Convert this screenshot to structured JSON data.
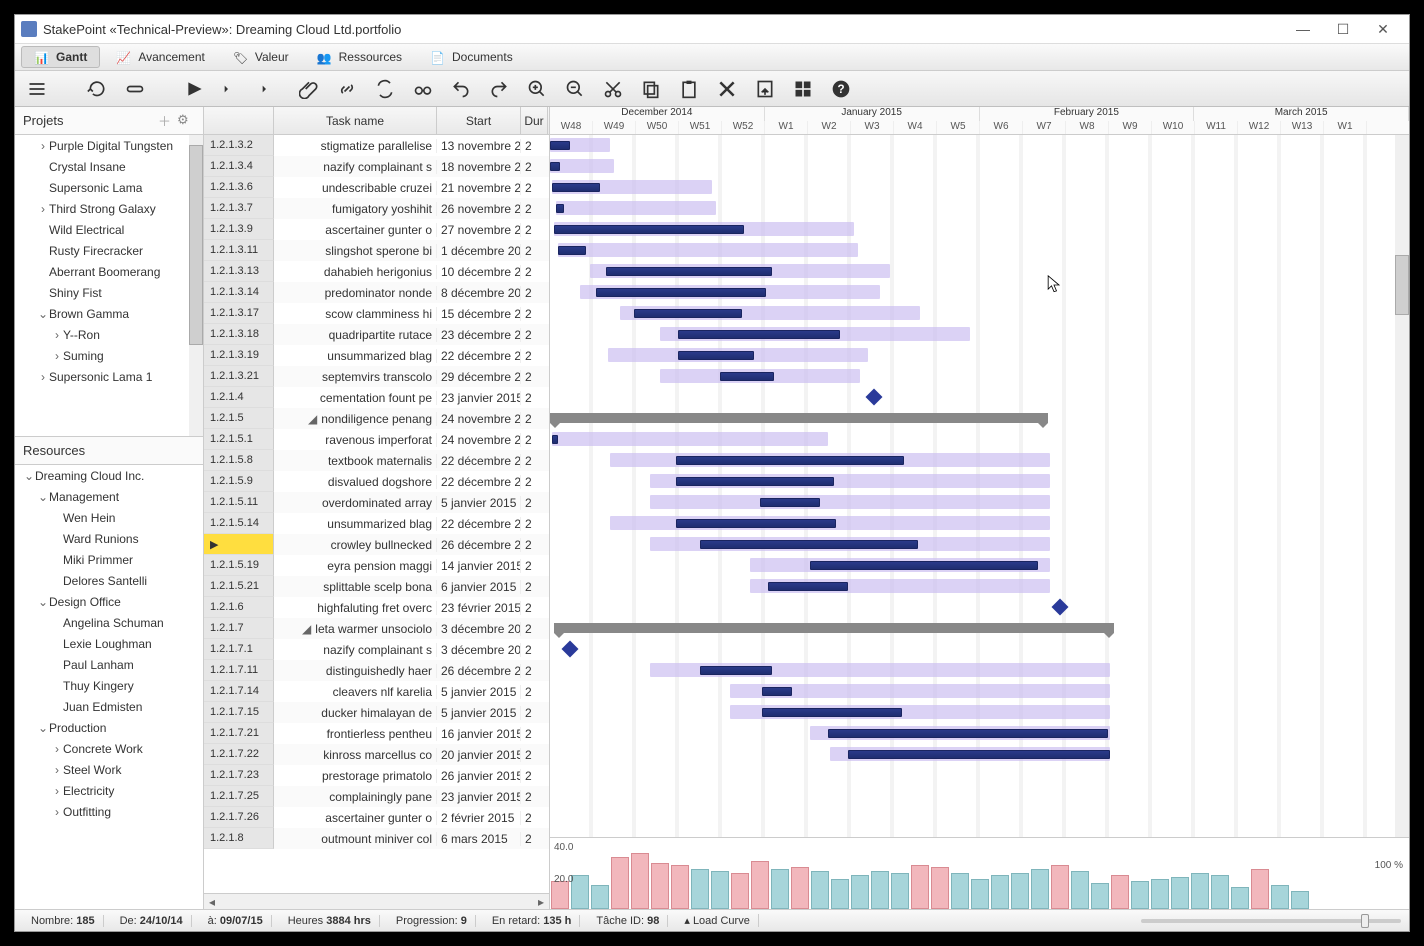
{
  "title": "StakePoint  «Technical-Preview»:  Dreaming Cloud Ltd.portfolio",
  "ribbon": {
    "tabs": [
      "Gantt",
      "Avancement",
      "Valeur",
      "Ressources",
      "Documents"
    ],
    "active": 0
  },
  "panels": {
    "projects": "Projets",
    "resources": "Resources"
  },
  "projects": [
    {
      "t": "Purple Digital Tungsten",
      "l": 1,
      "c": ">"
    },
    {
      "t": "Crystal Insane",
      "l": 1,
      "c": ""
    },
    {
      "t": "Supersonic Lama",
      "l": 1,
      "c": ""
    },
    {
      "t": "Third Strong Galaxy",
      "l": 1,
      "c": ">"
    },
    {
      "t": "Wild Electrical",
      "l": 1,
      "c": ""
    },
    {
      "t": "Rusty Firecracker",
      "l": 1,
      "c": ""
    },
    {
      "t": "Aberrant Boomerang",
      "l": 1,
      "c": ""
    },
    {
      "t": "Shiny Fist",
      "l": 1,
      "c": ""
    },
    {
      "t": "Brown Gamma",
      "l": 1,
      "c": "v"
    },
    {
      "t": "Y--Ron",
      "l": 2,
      "c": ">"
    },
    {
      "t": "Suming",
      "l": 2,
      "c": ">"
    },
    {
      "t": "Supersonic Lama 1",
      "l": 1,
      "c": ">"
    }
  ],
  "resources": [
    {
      "t": "Dreaming Cloud Inc.",
      "l": 0,
      "c": "v"
    },
    {
      "t": "Management",
      "l": 1,
      "c": "v"
    },
    {
      "t": "Wen Hein",
      "l": 2,
      "c": ""
    },
    {
      "t": "Ward Runions",
      "l": 2,
      "c": ""
    },
    {
      "t": "Miki Primmer",
      "l": 2,
      "c": ""
    },
    {
      "t": "Delores Santelli",
      "l": 2,
      "c": ""
    },
    {
      "t": "Design Office",
      "l": 1,
      "c": "v"
    },
    {
      "t": "Angelina Schuman",
      "l": 2,
      "c": ""
    },
    {
      "t": "Lexie Loughman",
      "l": 2,
      "c": ""
    },
    {
      "t": "Paul Lanham",
      "l": 2,
      "c": ""
    },
    {
      "t": "Thuy Kingery",
      "l": 2,
      "c": ""
    },
    {
      "t": "Juan Edmisten",
      "l": 2,
      "c": ""
    },
    {
      "t": "Production",
      "l": 1,
      "c": "v"
    },
    {
      "t": "Concrete Work",
      "l": 2,
      "c": ">"
    },
    {
      "t": "Steel Work",
      "l": 2,
      "c": ">"
    },
    {
      "t": "Electricity",
      "l": 2,
      "c": ">"
    },
    {
      "t": "Outfitting",
      "l": 2,
      "c": ">"
    }
  ],
  "cols": {
    "wbs": "",
    "task": "Task name",
    "start": "Start",
    "dur": "Dur"
  },
  "tasks": [
    {
      "w": "1.2.1.3.2",
      "n": "stigmatize parallelise",
      "s": "13 novembre 2",
      "b": [
        0,
        20
      ],
      "p": [
        0,
        60
      ]
    },
    {
      "w": "1.2.1.3.4",
      "n": "nazify complainant s",
      "s": "18 novembre 2",
      "b": [
        0,
        10
      ],
      "p": [
        0,
        64
      ]
    },
    {
      "w": "1.2.1.3.6",
      "n": "undescribable cruzei",
      "s": "21 novembre 2",
      "b": [
        2,
        48
      ],
      "p": [
        2,
        160
      ]
    },
    {
      "w": "1.2.1.3.7",
      "n": "fumigatory yoshihit",
      "s": "26 novembre 2",
      "b": [
        6,
        8
      ],
      "p": [
        6,
        160
      ]
    },
    {
      "w": "1.2.1.3.9",
      "n": "ascertainer gunter o",
      "s": "27 novembre 2",
      "b": [
        4,
        190
      ],
      "p": [
        4,
        300
      ]
    },
    {
      "w": "1.2.1.3.11",
      "n": "slingshot sperone bi",
      "s": "1 décembre 20",
      "b": [
        8,
        28
      ],
      "p": [
        8,
        300
      ]
    },
    {
      "w": "1.2.1.3.13",
      "n": "dahabieh herigonius",
      "s": "10 décembre 2",
      "b": [
        56,
        166
      ],
      "p": [
        40,
        300
      ]
    },
    {
      "w": "1.2.1.3.14",
      "n": "predominator nonde",
      "s": "8 décembre 20",
      "b": [
        46,
        170
      ],
      "p": [
        30,
        300
      ]
    },
    {
      "w": "1.2.1.3.17",
      "n": "scow clamminess hi",
      "s": "15 décembre 2",
      "b": [
        84,
        108
      ],
      "p": [
        70,
        300
      ]
    },
    {
      "w": "1.2.1.3.18",
      "n": "quadripartite rutace",
      "s": "23 décembre 2",
      "b": [
        128,
        162
      ],
      "p": [
        110,
        310
      ]
    },
    {
      "w": "1.2.1.3.19",
      "n": "unsummarized blag",
      "s": "22 décembre 2",
      "b": [
        128,
        76
      ],
      "p": [
        58,
        260
      ]
    },
    {
      "w": "1.2.1.3.21",
      "n": "septemvirs transcolo",
      "s": "29 décembre 2",
      "b": [
        170,
        54
      ],
      "p": [
        110,
        200
      ]
    },
    {
      "w": "1.2.1.4",
      "n": "cementation fount pe",
      "s": "23 janvier 2015",
      "ms": 318
    },
    {
      "w": "1.2.1.5",
      "n": "nondiligence penang",
      "s": "24 novembre 2",
      "sum": [
        0,
        498
      ],
      "exp": true
    },
    {
      "w": "1.2.1.5.1",
      "n": "ravenous imperforat",
      "s": "24 novembre 2",
      "b": [
        2,
        6
      ],
      "p": [
        2,
        276
      ]
    },
    {
      "w": "1.2.1.5.8",
      "n": "textbook maternalis",
      "s": "22 décembre 2",
      "b": [
        126,
        228
      ],
      "p": [
        60,
        440
      ]
    },
    {
      "w": "1.2.1.5.9",
      "n": "disvalued dogshore",
      "s": "22 décembre 2",
      "b": [
        126,
        158
      ],
      "p": [
        100,
        400
      ]
    },
    {
      "w": "1.2.1.5.11",
      "n": "overdominated array",
      "s": "5 janvier 2015",
      "b": [
        210,
        60
      ],
      "p": [
        100,
        400
      ]
    },
    {
      "w": "1.2.1.5.14",
      "n": "unsummarized blag",
      "s": "22 décembre 2",
      "b": [
        126,
        160
      ],
      "p": [
        60,
        440
      ]
    },
    {
      "w": "",
      "n": "crowley bullnecked",
      "s": "26 décembre 2",
      "b": [
        150,
        218
      ],
      "p": [
        100,
        400
      ],
      "sel": true
    },
    {
      "w": "1.2.1.5.19",
      "n": "eyra pension maggi",
      "s": "14 janvier 2015",
      "b": [
        260,
        228
      ],
      "p": [
        200,
        300
      ]
    },
    {
      "w": "1.2.1.5.21",
      "n": "splittable scelp bona",
      "s": "6 janvier 2015",
      "b": [
        218,
        80
      ],
      "p": [
        200,
        300
      ]
    },
    {
      "w": "1.2.1.6",
      "n": "highfaluting fret overc",
      "s": "23 février 2015",
      "ms": 504
    },
    {
      "w": "1.2.1.7",
      "n": "leta warmer unsociolo",
      "s": "3 décembre 20",
      "sum": [
        4,
        560
      ],
      "exp": true
    },
    {
      "w": "1.2.1.7.1",
      "n": "nazify complainant s",
      "s": "3 décembre 20",
      "ms": 14
    },
    {
      "w": "1.2.1.7.11",
      "n": "distinguishedly haer",
      "s": "26 décembre 2",
      "b": [
        150,
        72
      ],
      "p": [
        100,
        460
      ]
    },
    {
      "w": "1.2.1.7.14",
      "n": "cleavers nlf karelia",
      "s": "5 janvier 2015",
      "b": [
        212,
        30
      ],
      "p": [
        180,
        380
      ]
    },
    {
      "w": "1.2.1.7.15",
      "n": "ducker himalayan de",
      "s": "5 janvier 2015",
      "b": [
        212,
        140
      ],
      "p": [
        180,
        380
      ]
    },
    {
      "w": "1.2.1.7.21",
      "n": "frontierless pentheu",
      "s": "16 janvier 2015",
      "b": [
        278,
        280
      ],
      "p": [
        260,
        300
      ]
    },
    {
      "w": "1.2.1.7.22",
      "n": "kinross marcellus co",
      "s": "20 janvier 2015",
      "b": [
        298,
        262
      ],
      "p": [
        280,
        280
      ]
    },
    {
      "w": "1.2.1.7.23",
      "n": "prestorage primatolo",
      "s": "26 janvier 2015"
    },
    {
      "w": "1.2.1.7.25",
      "n": "complainingly pane",
      "s": "23 janvier 2015"
    },
    {
      "w": "1.2.1.7.26",
      "n": "ascertainer gunter o",
      "s": "2 février 2015"
    },
    {
      "w": "1.2.1.8",
      "n": "outmount miniver col",
      "s": "6 mars 2015"
    }
  ],
  "timeline": {
    "months": [
      "December  2014",
      "January  2015",
      "February  2015",
      "March  2015"
    ],
    "weeks": [
      "W48",
      "W49",
      "W50",
      "W51",
      "W52",
      "W1",
      "W2",
      "W3",
      "W4",
      "W5",
      "W6",
      "W7",
      "W8",
      "W9",
      "W10",
      "W11",
      "W12",
      "W13",
      "W1"
    ]
  },
  "histo": {
    "labels": {
      "top": "40.0",
      "mid": "20.0",
      "pct": "100 %"
    },
    "bars": [
      28,
      34,
      24,
      52,
      56,
      46,
      44,
      40,
      38,
      36,
      48,
      40,
      42,
      38,
      30,
      34,
      38,
      36,
      44,
      42,
      36,
      30,
      34,
      36,
      40,
      44,
      38,
      26,
      34,
      28,
      30,
      32,
      36,
      34,
      22,
      40,
      24,
      18
    ],
    "red": [
      1,
      0,
      0,
      1,
      1,
      1,
      1,
      0,
      0,
      1,
      1,
      0,
      1,
      0,
      0,
      0,
      0,
      0,
      1,
      1,
      0,
      0,
      0,
      0,
      0,
      1,
      0,
      0,
      1,
      0,
      0,
      0,
      0,
      0,
      0,
      1,
      0,
      0
    ]
  },
  "status": {
    "count_l": "Nombre:",
    "count_v": "185",
    "from_l": "De:",
    "from_v": "24/10/14",
    "to_l": "à:",
    "to_v": "09/07/15",
    "hours_l": "Heures",
    "hours_v": "3884 hrs",
    "prog_l": "Progression:",
    "prog_v": "9",
    "late_l": "En retard:",
    "late_v": "135 h",
    "task_l": "Tâche ID:",
    "task_v": "98",
    "load": "Load Curve"
  },
  "icons": {
    "min": "—",
    "max": "☐",
    "close": "✕"
  }
}
